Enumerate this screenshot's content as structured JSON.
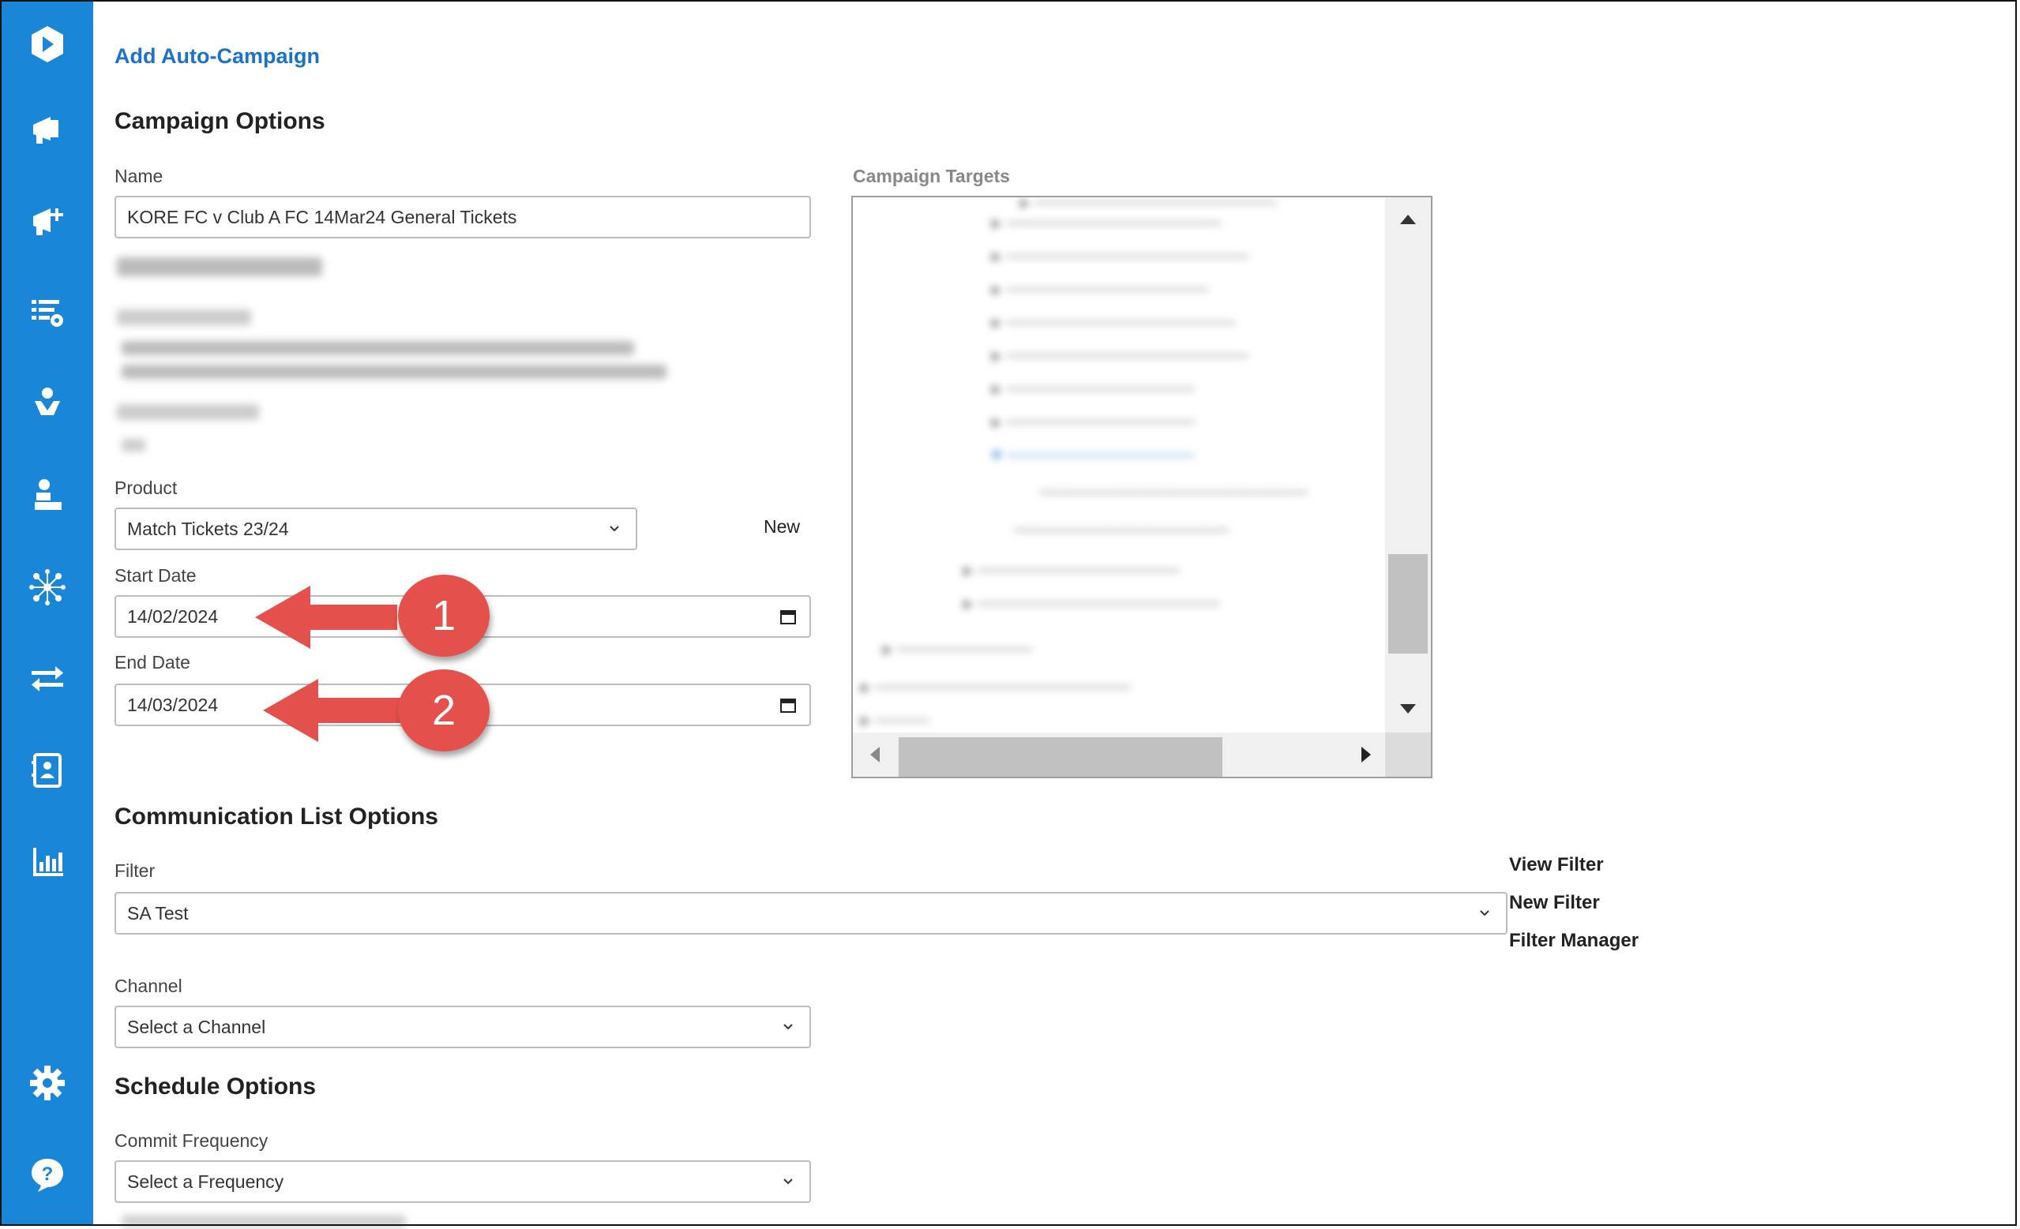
{
  "sidebar": {
    "icons": [
      "logo-icon",
      "megaphone-icon",
      "megaphone-add-icon",
      "list-settings-icon",
      "person-heart-icon",
      "person-desk-icon",
      "network-icon",
      "transfer-icon",
      "contact-card-icon",
      "bar-chart-icon",
      "settings-icon",
      "help-icon"
    ],
    "color": "#1a86d8"
  },
  "page": {
    "title": "Add Auto-Campaign"
  },
  "campaign_options": {
    "heading": "Campaign Options",
    "name_label": "Name",
    "name_value": "KORE FC v Club A FC 14Mar24 General Tickets",
    "product_label": "Product",
    "product_value": "Match Tickets 23/24",
    "product_new_link": "New",
    "start_date_label": "Start Date",
    "start_date_value": "14/02/2024",
    "end_date_label": "End Date",
    "end_date_value": "14/03/2024",
    "targets_label": "Campaign Targets"
  },
  "communication_list_options": {
    "heading": "Communication List Options",
    "filter_label": "Filter",
    "filter_value": "SA Test",
    "view_filter": "View Filter",
    "new_filter": "New Filter",
    "filter_manager": "Filter Manager",
    "channel_label": "Channel",
    "channel_placeholder": "Select a Channel"
  },
  "schedule_options": {
    "heading": "Schedule Options",
    "commit_frequency_label": "Commit Frequency",
    "commit_frequency_placeholder": "Select a Frequency"
  },
  "annotations": {
    "step1": "1",
    "step2": "2",
    "color": "#e4514c"
  }
}
